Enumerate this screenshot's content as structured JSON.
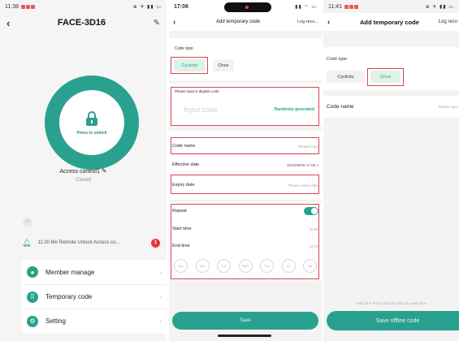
{
  "colors": {
    "accent": "#2aa18f",
    "highlight": "#d8464b",
    "badge": "#e03a3a"
  },
  "phone1": {
    "status_time": "11:38",
    "title": "FACE-3D16",
    "press_to_unlock": "Press to unlock",
    "access_name": "Access control1",
    "access_status": "Closed",
    "notification": "11:30 Me  Remote Unlock Access co...",
    "notification_badge": "1",
    "menu": [
      {
        "label": "Member manage",
        "icon": "person-icon"
      },
      {
        "label": "Temporary code",
        "icon": "keypad-icon"
      },
      {
        "label": "Setting",
        "icon": "gear-icon"
      }
    ]
  },
  "phone2": {
    "status_time": "17:06",
    "title": "Add temporary code",
    "log_link": "Log reco...",
    "code_type_label": "Code type",
    "cyclicity": "Cyclicity",
    "once": "Once",
    "input_hint": "Please input 6 digitals code",
    "input_placeholder": "Input code",
    "randomly_generated": "Randomly generated",
    "code_name": "Code name",
    "code_name_placeholder": "Please input",
    "effective_date": "Effective date",
    "effective_value": "2023/08/05 17:06 >",
    "expiry_date": "Expiry date",
    "expiry_placeholder": "Please select date",
    "repeat": "Repeat",
    "start_time": "Start time",
    "start_value": "00:00",
    "end_time": "End time",
    "end_value": "23:00",
    "days": [
      "Sun",
      "Mon",
      "Tue",
      "Wed",
      "Thu",
      "Fri",
      "Sat"
    ],
    "save": "Save"
  },
  "phone3": {
    "status_time": "11:41",
    "title": "Add temporary code",
    "log_link": "Log reco",
    "code_type_label": "Code type",
    "cyclicity": "Cyclicity",
    "once": "Once",
    "code_name": "Code name",
    "code_name_placeholder": "Please inpu",
    "hint": "valid for 6 hours and can only be used once",
    "save_offline": "Save offline code"
  }
}
